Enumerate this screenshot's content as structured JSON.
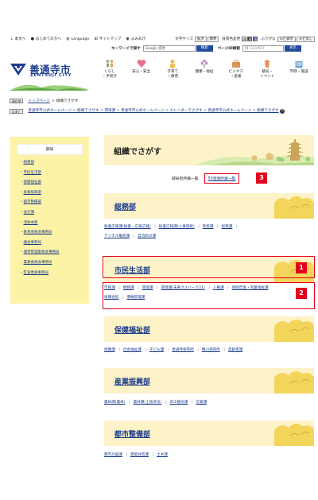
{
  "util": {
    "links": [
      {
        "label": "本文へ",
        "icon": "arrow-down-icon"
      },
      {
        "label": "はじめての方へ",
        "icon": "info-icon"
      },
      {
        "label": "Language",
        "icon": "globe-icon"
      },
      {
        "label": "サイトマップ",
        "icon": "sitemap-icon"
      },
      {
        "label": "よみあげ",
        "icon": "speaker-icon"
      }
    ],
    "font_size_label": "文字サイズ",
    "font_size_buttons": [
      "拡大",
      "標準"
    ],
    "bg_color_label": "背景色変更",
    "bg_colors": [
      "白",
      "黒",
      "青"
    ],
    "furigana_label": "ふりがな",
    "furigana_buttons": [
      "ルビ表示",
      "ルビなし"
    ]
  },
  "search": {
    "keyword_label": "キーワードで探す",
    "keyword_placeholder": "Google 提供",
    "keyword_button": "検索",
    "page_id_label": "ページID検索",
    "page_id_placeholder": "例 1234567",
    "page_id_button": "表示"
  },
  "header": {
    "logo_jp": "善通寺市",
    "logo_en": "ZENTSUJI CITY",
    "nav": [
      {
        "label": "くらし\n・手続き",
        "icon": "family-icon"
      },
      {
        "label": "安心・安全",
        "icon": "heart-icon"
      },
      {
        "label": "子育て\n・教育",
        "icon": "child-icon"
      },
      {
        "label": "健康・福祉",
        "icon": "flower-icon"
      },
      {
        "label": "ビジネス\n・産業",
        "icon": "briefcase-icon"
      },
      {
        "label": "観光・\nイベント",
        "icon": "pagoda-icon"
      },
      {
        "label": "市政・施設",
        "icon": "building-icon"
      }
    ]
  },
  "breadcrumb1": {
    "tag": "現在地",
    "items": [
      "トップページ",
      "組織でさがす"
    ]
  },
  "breadcrumb2": {
    "tag": "足あと",
    "text": "善通寺市公式ホームページ > 組織でさがす > 環境課 > 善通寺市公式ホームページ > カレンダーでさがす > 善通寺市公式ホームページ > 組織でさがす"
  },
  "side": {
    "heading": "部局",
    "items": [
      "総務部",
      "市民生活部",
      "保健福祉部",
      "産業振興部",
      "都市整備部",
      "会計課",
      "消防本部",
      "教育委員会事務局",
      "議会事務局",
      "選挙管理委員会事務局",
      "農業委員会事務局",
      "監査委員事務局"
    ]
  },
  "main": {
    "title": "組織でさがす",
    "list_current": "部局別所属一覧",
    "list_link": "50音順所属一覧",
    "annotations": [
      "1",
      "2",
      "3"
    ],
    "sections": [
      {
        "name": "総務部",
        "links": [
          "秘書広報課(秘書・広報広聴)",
          "秘書広報課(人事研修)",
          "政策課",
          "総務課",
          "デジタル推進課",
          "自治防災課"
        ]
      },
      {
        "name": "市民生活部",
        "links": [
          "市民課",
          "税務課",
          "環境課",
          "環境課(未来クルバーク21)",
          "人権課",
          "保険年金・児童福祉課",
          "後期会館",
          "債権管理課"
        ]
      },
      {
        "name": "保健福祉部",
        "links": [
          "保健課",
          "社会福祉課",
          "子ども課",
          "善通寺保育所",
          "鴨川保育所",
          "高齢者課"
        ]
      },
      {
        "name": "産業振興部",
        "links": [
          "農林課(農林)",
          "農林課(土地改良)",
          "商工観光課",
          "営業課"
        ]
      },
      {
        "name": "都市整備部",
        "links": [
          "都市計画課",
          "建築住宅課",
          "土木課"
        ]
      }
    ]
  },
  "colors": {
    "accent_red": "#e5001b",
    "link_blue": "#1a3c8c",
    "yellow": "#fcf3a6",
    "banner": "#fdf2c8"
  }
}
